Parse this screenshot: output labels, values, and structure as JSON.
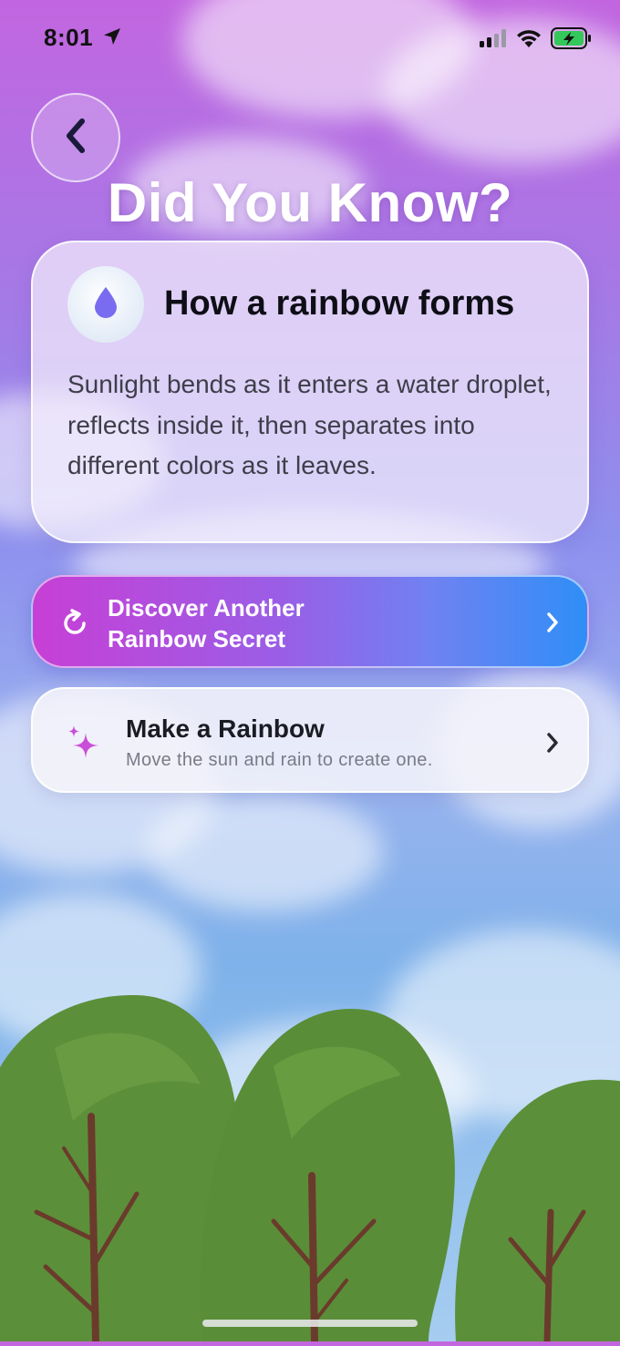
{
  "status_bar": {
    "time": "8:01",
    "location_icon": "location-arrow-icon",
    "signal_icon": "cellular-signal-icon",
    "wifi_icon": "wifi-icon",
    "battery_icon": "battery-charging-icon"
  },
  "nav": {
    "back_icon": "chevron-left-icon"
  },
  "page": {
    "title": "Did You Know?"
  },
  "fact_card": {
    "icon": "water-drop-icon",
    "title": "How a rainbow forms",
    "body": "Sunlight bends as it enters a water droplet, reflects inside it, then separates into different colors as it leaves."
  },
  "discover_button": {
    "icon": "refresh-icon",
    "label": "Discover Another Rainbow Secret",
    "chevron": "chevron-right-icon"
  },
  "make_rainbow": {
    "icon": "sparkles-icon",
    "title": "Make a Rainbow",
    "subtitle": "Move the sun and rain to create one.",
    "chevron": "chevron-right-icon"
  },
  "colors": {
    "accent_gradient_start": "#c73fd6",
    "accent_gradient_end": "#2f8ef7",
    "drop_icon": "#7a6cf0",
    "sparkle_icon": "#c94fd8",
    "tree_green": "#5c8f3a",
    "trunk_brown": "#6a3b2c"
  }
}
